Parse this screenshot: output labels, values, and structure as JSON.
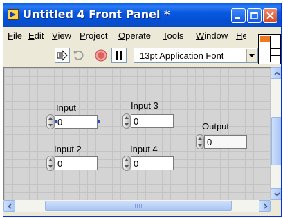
{
  "window": {
    "title": "Untitled 4 Front Panel *"
  },
  "menubar": {
    "items": [
      {
        "label": "File",
        "accel": "F",
        "rest": "ile"
      },
      {
        "label": "Edit",
        "accel": "E",
        "rest": "dit"
      },
      {
        "label": "View",
        "accel": "V",
        "rest": "iew"
      },
      {
        "label": "Project",
        "accel": "P",
        "rest": "roject"
      },
      {
        "label": "Operate",
        "accel": "O",
        "rest": "perate"
      },
      {
        "label": "Tools",
        "accel": "T",
        "rest": "ools"
      },
      {
        "label": "Window",
        "accel": "W",
        "rest": "indow"
      },
      {
        "label": "Help",
        "accel": "H",
        "rest": "elp"
      }
    ]
  },
  "toolbar": {
    "font_select": "13pt Application Font",
    "icons": [
      "run-arrow-icon",
      "run-continuously-icon",
      "abort-icon",
      "pause-icon"
    ]
  },
  "controls": [
    {
      "label": "Input",
      "value": "0",
      "selected": true
    },
    {
      "label": "Input 2",
      "value": "0"
    },
    {
      "label": "Input 3",
      "value": "0"
    },
    {
      "label": "Input 4",
      "value": "0"
    }
  ],
  "indicator": {
    "label": "Output",
    "value": "0"
  }
}
